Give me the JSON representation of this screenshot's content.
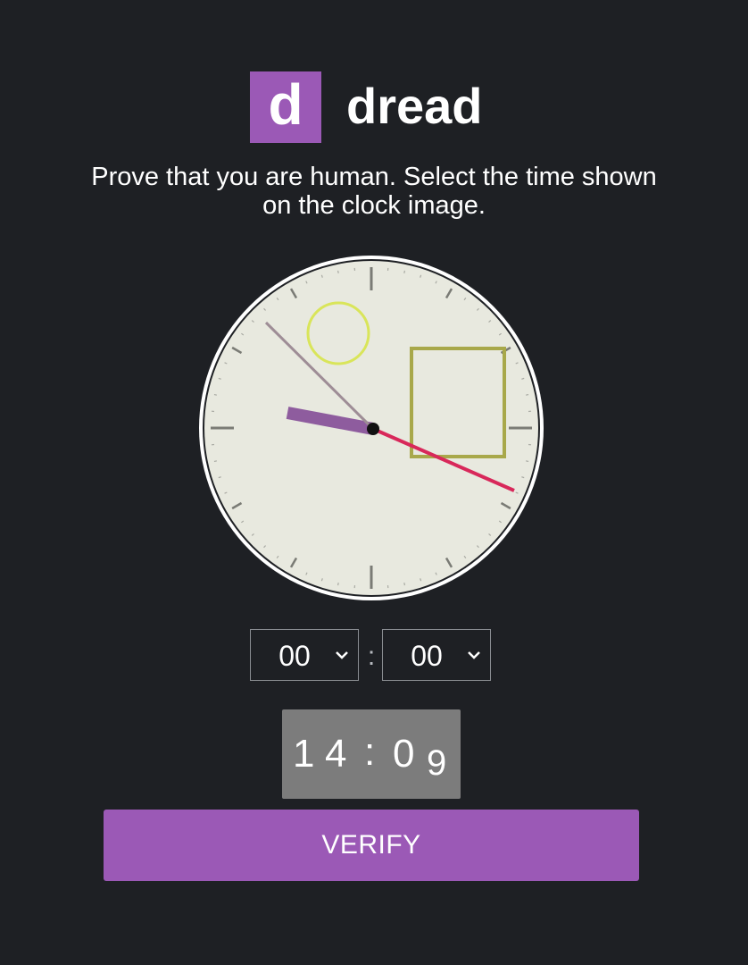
{
  "brand": {
    "logo_letter": "d",
    "name": "dread",
    "accent_color": "#9b59b6"
  },
  "instructions": "Prove that you are human. Select the time shown on the clock image.",
  "clock": {
    "hour_hand_color": "#8e5c9e",
    "minute_hand_color": "#9e8d96",
    "second_hand_color": "#d8285a",
    "decorations": [
      "yellow-circle",
      "olive-square"
    ]
  },
  "time_picker": {
    "hour_value": "00",
    "separator": ":",
    "minute_value": "00"
  },
  "captcha_code": {
    "chars": [
      "1",
      "4",
      ":",
      "0",
      "9"
    ]
  },
  "verify_button": {
    "label": "VERIFY"
  }
}
